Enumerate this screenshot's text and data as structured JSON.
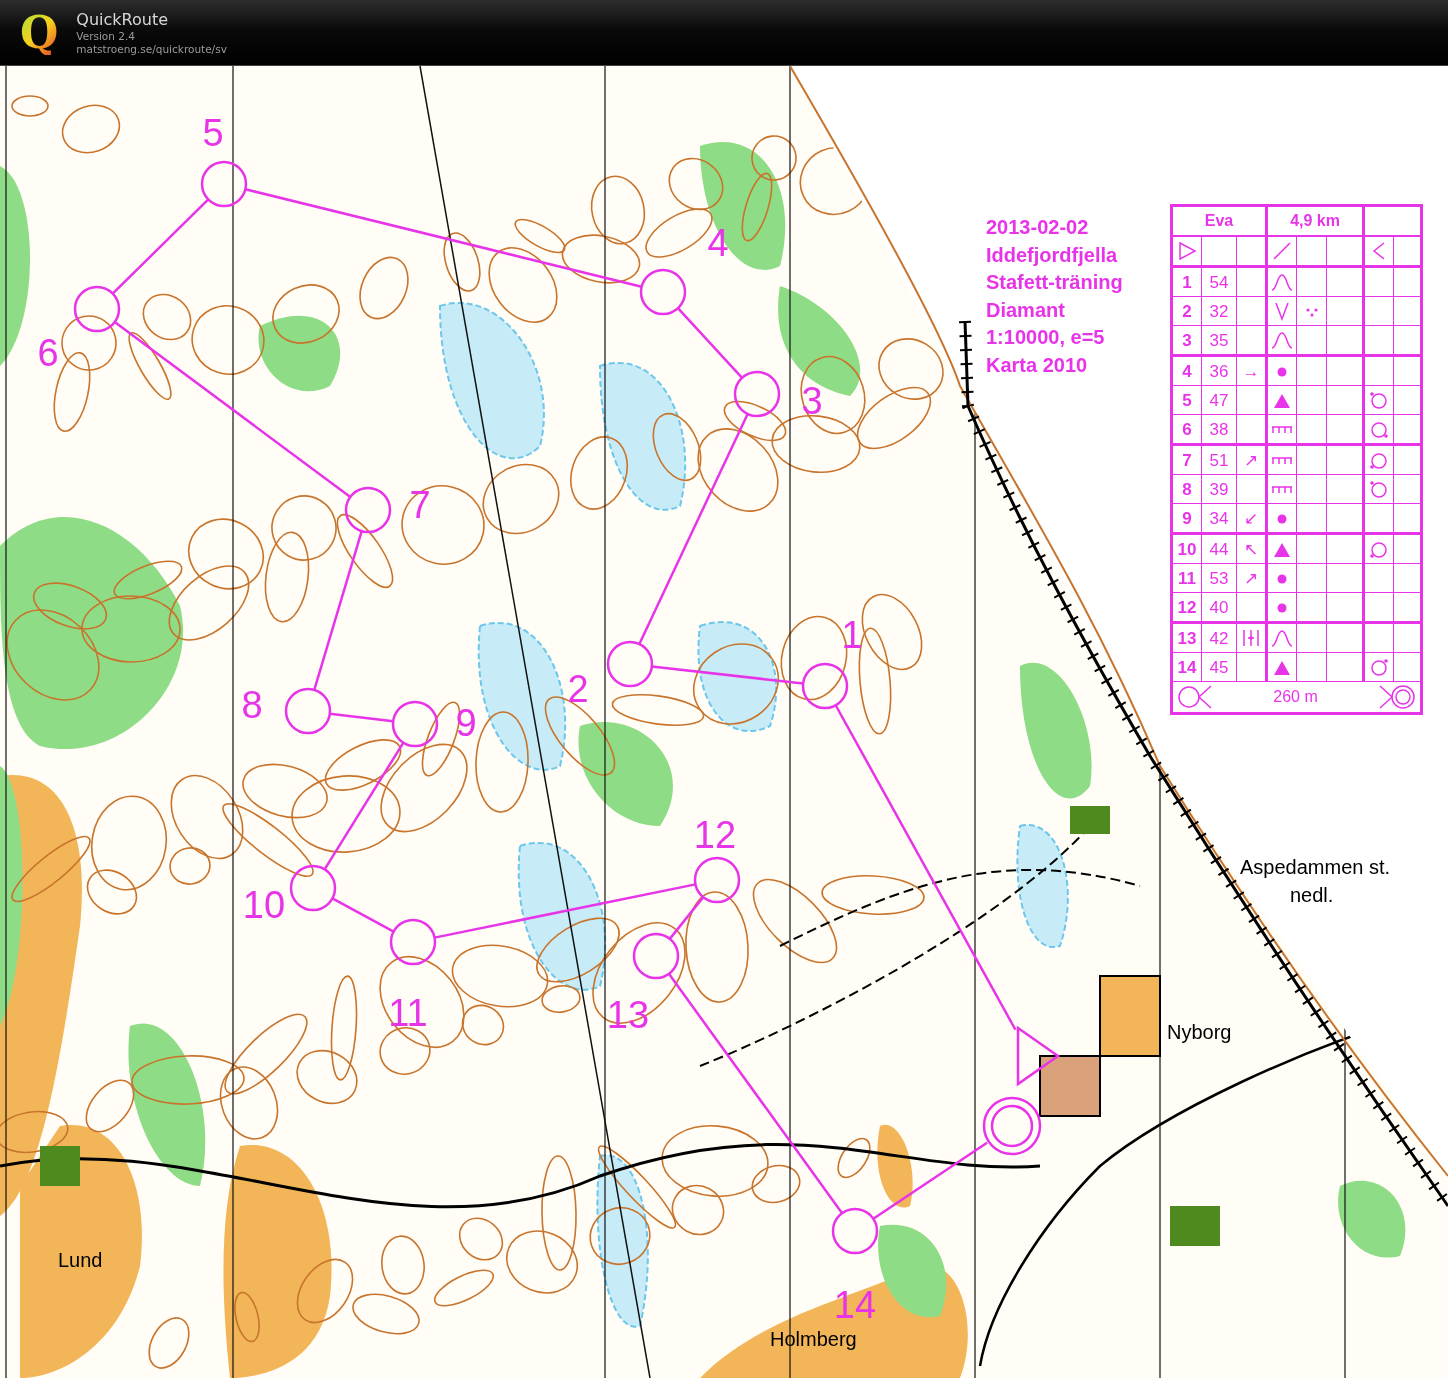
{
  "app": {
    "logo": "Q",
    "name": "QuickRoute",
    "version": "Version 2.4",
    "url": "matstroeng.se/quickroute/sv"
  },
  "map": {
    "place_names": [
      {
        "text": "Aspedammen st."
      },
      {
        "text": "nedl."
      },
      {
        "text": "Nyborg"
      },
      {
        "text": "Lund"
      },
      {
        "text": "Holmberg"
      }
    ],
    "course_info": [
      "2013-02-02",
      "Iddefjordfjella",
      "Stafett-träning",
      "Diamant",
      "1:10000, e=5",
      "Karta 2010"
    ],
    "controls": [
      {
        "label": "1"
      },
      {
        "label": "2"
      },
      {
        "label": "3"
      },
      {
        "label": "4"
      },
      {
        "label": "5"
      },
      {
        "label": "6"
      },
      {
        "label": "7"
      },
      {
        "label": "8"
      },
      {
        "label": "9"
      },
      {
        "label": "10"
      },
      {
        "label": "11"
      },
      {
        "label": "12"
      },
      {
        "label": "13"
      },
      {
        "label": "14"
      }
    ],
    "description": {
      "name": "Eva",
      "length": "4,9 km",
      "rows": [
        {
          "number": "1",
          "code": "54",
          "feature": {
            "kind": "knoll"
          }
        },
        {
          "number": "2",
          "code": "32",
          "feature": {
            "kind": "depression"
          },
          "appearance": {
            "kind": "stony"
          }
        },
        {
          "number": "3",
          "code": "35",
          "feature": {
            "kind": "knoll"
          }
        },
        {
          "number": "4",
          "code": "36",
          "direction": "→",
          "feature": {
            "kind": "dot"
          }
        },
        {
          "number": "5",
          "code": "47",
          "feature": {
            "kind": "boulder"
          },
          "location": {
            "kind": "nw"
          }
        },
        {
          "number": "6",
          "code": "38",
          "feature": {
            "kind": "cliff"
          },
          "location": {
            "kind": "se"
          }
        },
        {
          "number": "7",
          "code": "51",
          "direction": "↗",
          "feature": {
            "kind": "cliff"
          },
          "location": {
            "kind": "sw"
          }
        },
        {
          "number": "8",
          "code": "39",
          "feature": {
            "kind": "cliff"
          },
          "location": {
            "kind": "nw"
          }
        },
        {
          "number": "9",
          "code": "34",
          "direction": "↙",
          "feature": {
            "kind": "dot"
          }
        },
        {
          "number": "10",
          "code": "44",
          "direction": "↖",
          "feature": {
            "kind": "boulder"
          },
          "location": {
            "kind": "sw"
          }
        },
        {
          "number": "11",
          "code": "53",
          "direction": "↗",
          "feature": {
            "kind": "dot"
          }
        },
        {
          "number": "12",
          "code": "40",
          "feature": {
            "kind": "dot"
          }
        },
        {
          "number": "13",
          "code": "42",
          "which": {
            "kind": "between"
          },
          "feature": {
            "kind": "knoll"
          }
        },
        {
          "number": "14",
          "code": "45",
          "feature": {
            "kind": "boulder"
          },
          "location": {
            "kind": "ne"
          }
        }
      ],
      "footer": "260 m"
    }
  }
}
